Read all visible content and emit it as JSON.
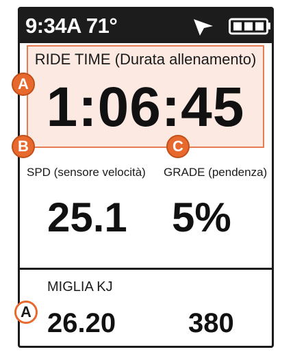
{
  "status_bar": {
    "time_temp": "9:34A 71°",
    "gps_icon": "navigation-arrow-icon",
    "battery_icon": "battery-full-icon"
  },
  "fields": {
    "ride_time": {
      "label": "RIDE TIME (Durata allenamento)",
      "value": "1:06:45"
    },
    "speed": {
      "label": "SPD (sensore velocità)",
      "value": "25.1"
    },
    "grade": {
      "label": "GRADE (pendenza)",
      "value": "5%"
    },
    "bottom": {
      "label": "MIGLIA KJ",
      "value_left": "26.20",
      "value_right": "380"
    }
  },
  "callouts": {
    "a": "A",
    "b": "B",
    "c": "C"
  },
  "colors": {
    "status_bar_bg": "#1c1c1c",
    "callout_orange": "#e7692d",
    "highlight_bg": "#fbe9e2",
    "highlight_border": "#e57c54"
  }
}
